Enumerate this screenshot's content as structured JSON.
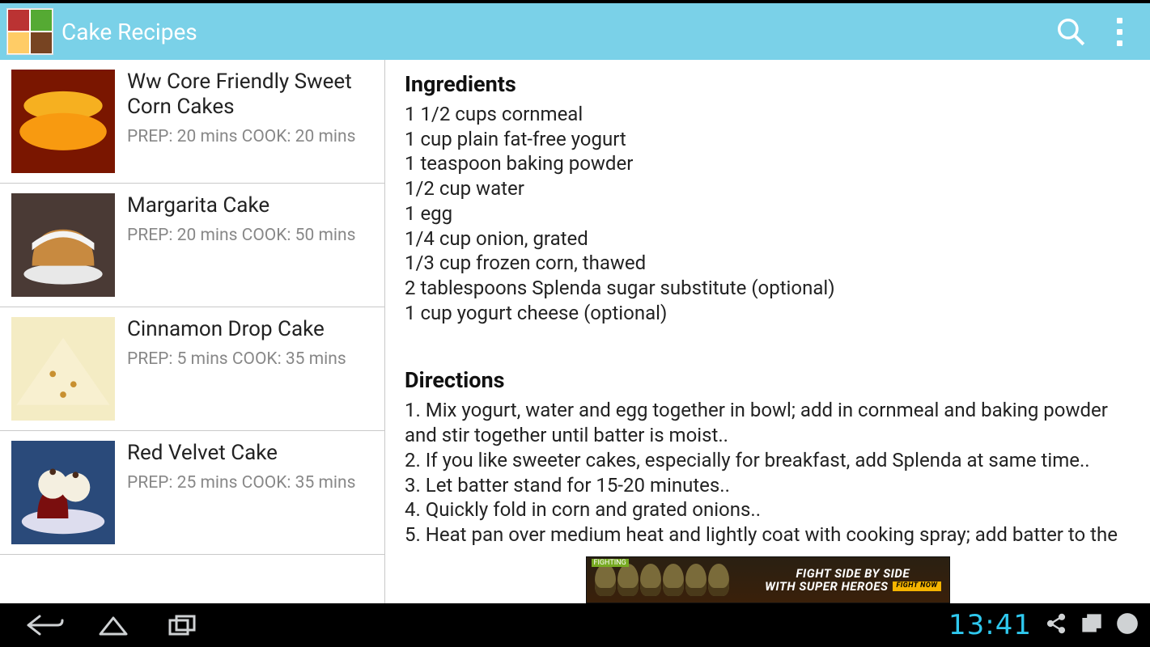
{
  "header": {
    "title": "Cake Recipes"
  },
  "sidebar": {
    "items": [
      {
        "name": "Ww Core Friendly Sweet Corn Cakes",
        "meta": "PREP: 20 mins  COOK: 20 mins",
        "thumbBg": "#f4a815",
        "thumbShape": "pancake"
      },
      {
        "name": "Margarita Cake",
        "meta": "PREP: 20 mins  COOK: 50 mins",
        "thumbBg": "#5a3a2a",
        "thumbShape": "bundt"
      },
      {
        "name": "Cinnamon Drop Cake",
        "meta": "PREP: 5 mins  COOK: 35 mins",
        "thumbBg": "#f0e4b0",
        "thumbShape": "slice"
      },
      {
        "name": "Red Velvet Cake",
        "meta": "PREP: 25 mins  COOK: 35 mins",
        "thumbBg": "#3a5a8a",
        "thumbShape": "redvelvet"
      }
    ]
  },
  "detail": {
    "ingredientsHeader": "Ingredients",
    "ingredients": [
      "1 1/2 cups cornmeal",
      "1 cup plain fat-free yogurt",
      "1 teaspoon baking powder",
      "1/2 cup water",
      "1 egg",
      "1/4 cup onion, grated",
      "1/3 cup frozen corn, thawed",
      "2 tablespoons Splenda sugar substitute (optional)",
      "1 cup yogurt cheese (optional)"
    ],
    "directionsHeader": "Directions",
    "directions": [
      "1. Mix yogurt, water and egg together in bowl; add in cornmeal and baking powder and stir together until batter is moist..",
      "2. If you like sweeter cakes, especially for breakfast, add Splenda at same time..",
      "3. Let batter stand for 15-20 minutes..",
      "4. Quickly fold in corn and grated onions..",
      "5. Heat pan over medium heat and lightly coat with cooking spray; add batter to the"
    ]
  },
  "ad": {
    "tag": "FIGHTING",
    "line1": "FIGHT SIDE BY SIDE",
    "line2": "WITH SUPER HEROES",
    "cta": "FIGHT NOW"
  },
  "navbar": {
    "time": "13:41"
  }
}
